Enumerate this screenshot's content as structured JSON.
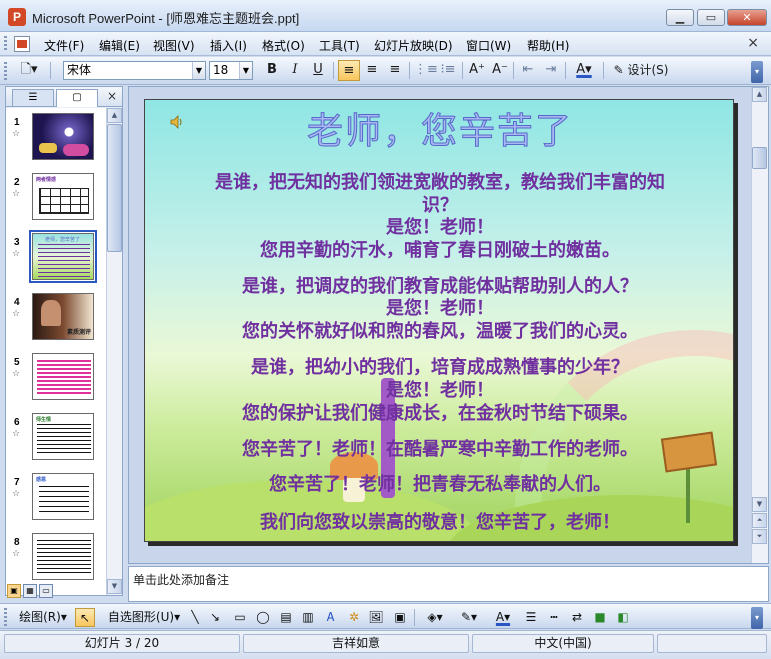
{
  "window": {
    "title": "Microsoft PowerPoint - [师恩难忘主题班会.ppt]",
    "app_icon_letter": "P",
    "minimize_glyph": "▁",
    "maximize_glyph": "▭",
    "close_glyph": "✕"
  },
  "menu": {
    "items": [
      "文件(F)",
      "编辑(E)",
      "视图(V)",
      "插入(I)",
      "格式(O)",
      "工具(T)",
      "幻灯片放映(D)",
      "窗口(W)",
      "帮助(H)"
    ],
    "doc_close_glyph": "×"
  },
  "toolbar": {
    "font_name": "宋体",
    "font_size": "18",
    "bold": "B",
    "italic": "I",
    "underline": "U",
    "design_label": "设计(S)"
  },
  "left_pane": {
    "tab_outline_glyph": "☰",
    "tab_slides_glyph": "▢",
    "close_glyph": "×",
    "slides": [
      {
        "number": "1",
        "label": "",
        "selected": false
      },
      {
        "number": "2",
        "label": "两者情感",
        "selected": false
      },
      {
        "number": "3",
        "label": "老师，您辛苦了",
        "selected": true
      },
      {
        "number": "4",
        "label": "素质测评",
        "selected": false
      },
      {
        "number": "5",
        "label": "",
        "selected": false
      },
      {
        "number": "6",
        "label": "师生情",
        "selected": false
      },
      {
        "number": "7",
        "label": "感恩",
        "selected": false
      },
      {
        "number": "8",
        "label": "",
        "selected": false
      }
    ],
    "star_glyph": "☆"
  },
  "slide": {
    "title": "老师，您辛苦了",
    "lines": [
      "是谁，把无知的我们领进宽敞的教室，教给我们丰富的知",
      "识？",
      "是您！老师！",
      "您用辛勤的汗水，哺育了春日刚破土的嫩苗。",
      "是谁，把调皮的我们教育成能体贴帮助别人的人？",
      "是您！老师！",
      "您的关怀就好似和煦的春风，温暖了我们的心灵。",
      "是谁，把幼小的我们，培育成成熟懂事的少年？",
      "是您！老师！",
      "您的保护让我们健康成长，在金秋时节结下硕果。",
      "您辛苦了！老师！在酷暑严寒中辛勤工作的老师。",
      "您辛苦了！老师！把青春无私奉献的人们。",
      "我们向您致以崇高的敬意！您辛苦了，老师！"
    ],
    "colors": {
      "title_fill": "#a7b8f2",
      "title_stroke": "#5869c9",
      "text": "#7030a0"
    }
  },
  "notes": {
    "placeholder": "单击此处添加备注"
  },
  "drawing_toolbar": {
    "draw_label": "绘图(R)",
    "autoshapes_label": "自选图形(U)"
  },
  "status": {
    "slide_position": "幻灯片 3 / 20",
    "design_name": "吉祥如意",
    "language": "中文(中国)"
  }
}
